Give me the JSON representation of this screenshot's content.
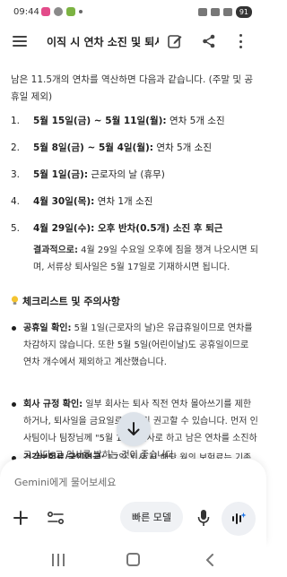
{
  "status_bar": {
    "time": "09:44",
    "battery": "91"
  },
  "app_bar": {
    "title": "이직 시 연차 소진 및 퇴사...",
    "icons": [
      "menu-icon",
      "edit-icon",
      "share-icon",
      "more-icon"
    ]
  },
  "intro": "남은 11.5개의 연차를 역산하면 다음과 같습니다. (주말 및 공휴일 제외)",
  "steps": [
    {
      "num": "1.",
      "bold": "5월 15일(금) ~ 5월 11일(월):",
      "rest": " 연차 5개 소진"
    },
    {
      "num": "2.",
      "bold": "5월 8일(금) ~ 5월 4일(월):",
      "rest": " 연차 5개 소진"
    },
    {
      "num": "3.",
      "bold": "5월 1일(금):",
      "rest": " 근로자의 날 (휴무)"
    },
    {
      "num": "4.",
      "bold": "4월 30일(목):",
      "rest": " 연차 1개 소진"
    },
    {
      "num": "5.",
      "bold": "4월 29일(수): 오후 반차(0.5개) 소진 후 퇴근",
      "rest": ""
    }
  ],
  "conclusion": {
    "label": "결과적으로:",
    "text": " 4월 29일 수요일 오후에 짐을 챙겨 나오시면 되며, 서류상 퇴사일은 5월 17일로 기재하시면 됩니다."
  },
  "checklist": {
    "heading": "체크리스트 및 주의사항",
    "items": [
      {
        "label": "공휴일 확인:",
        "text": " 5월 1일(근로자의 날)은 유급휴일이므로 연차를 차감하지 않습니다. 또한 5월 5일(어린이날)도 공휴일이므로 연차 개수에서 제외하고 계산했습니다."
      },
      {
        "label": "회사 규정 확인:",
        "text": " 일부 회사는 퇴사 직전 연차 몰아쓰기를 제한하거나, 퇴사일을 금요일로 맞추길 권고할 수 있습니다. 먼저 인사팀이나 팀장님께 \"5월 17일 퇴사로 하고 남은 연차를 소진하고 싶다\"고 의사를 밝히는 것이 좋습니다."
      },
      {
        "label": "건강보험료/국민연금:",
        "text": " 17일 퇴사 시 해당 월의 보험료는 기존"
      }
    ]
  },
  "composer": {
    "placeholder": "Gemini에게 물어보세요",
    "model_button": "빠른 모델"
  },
  "colors": {
    "accent": "#1f1f1f",
    "composer_bg": "#ffffff",
    "scroll_button": "#dde3ea"
  }
}
